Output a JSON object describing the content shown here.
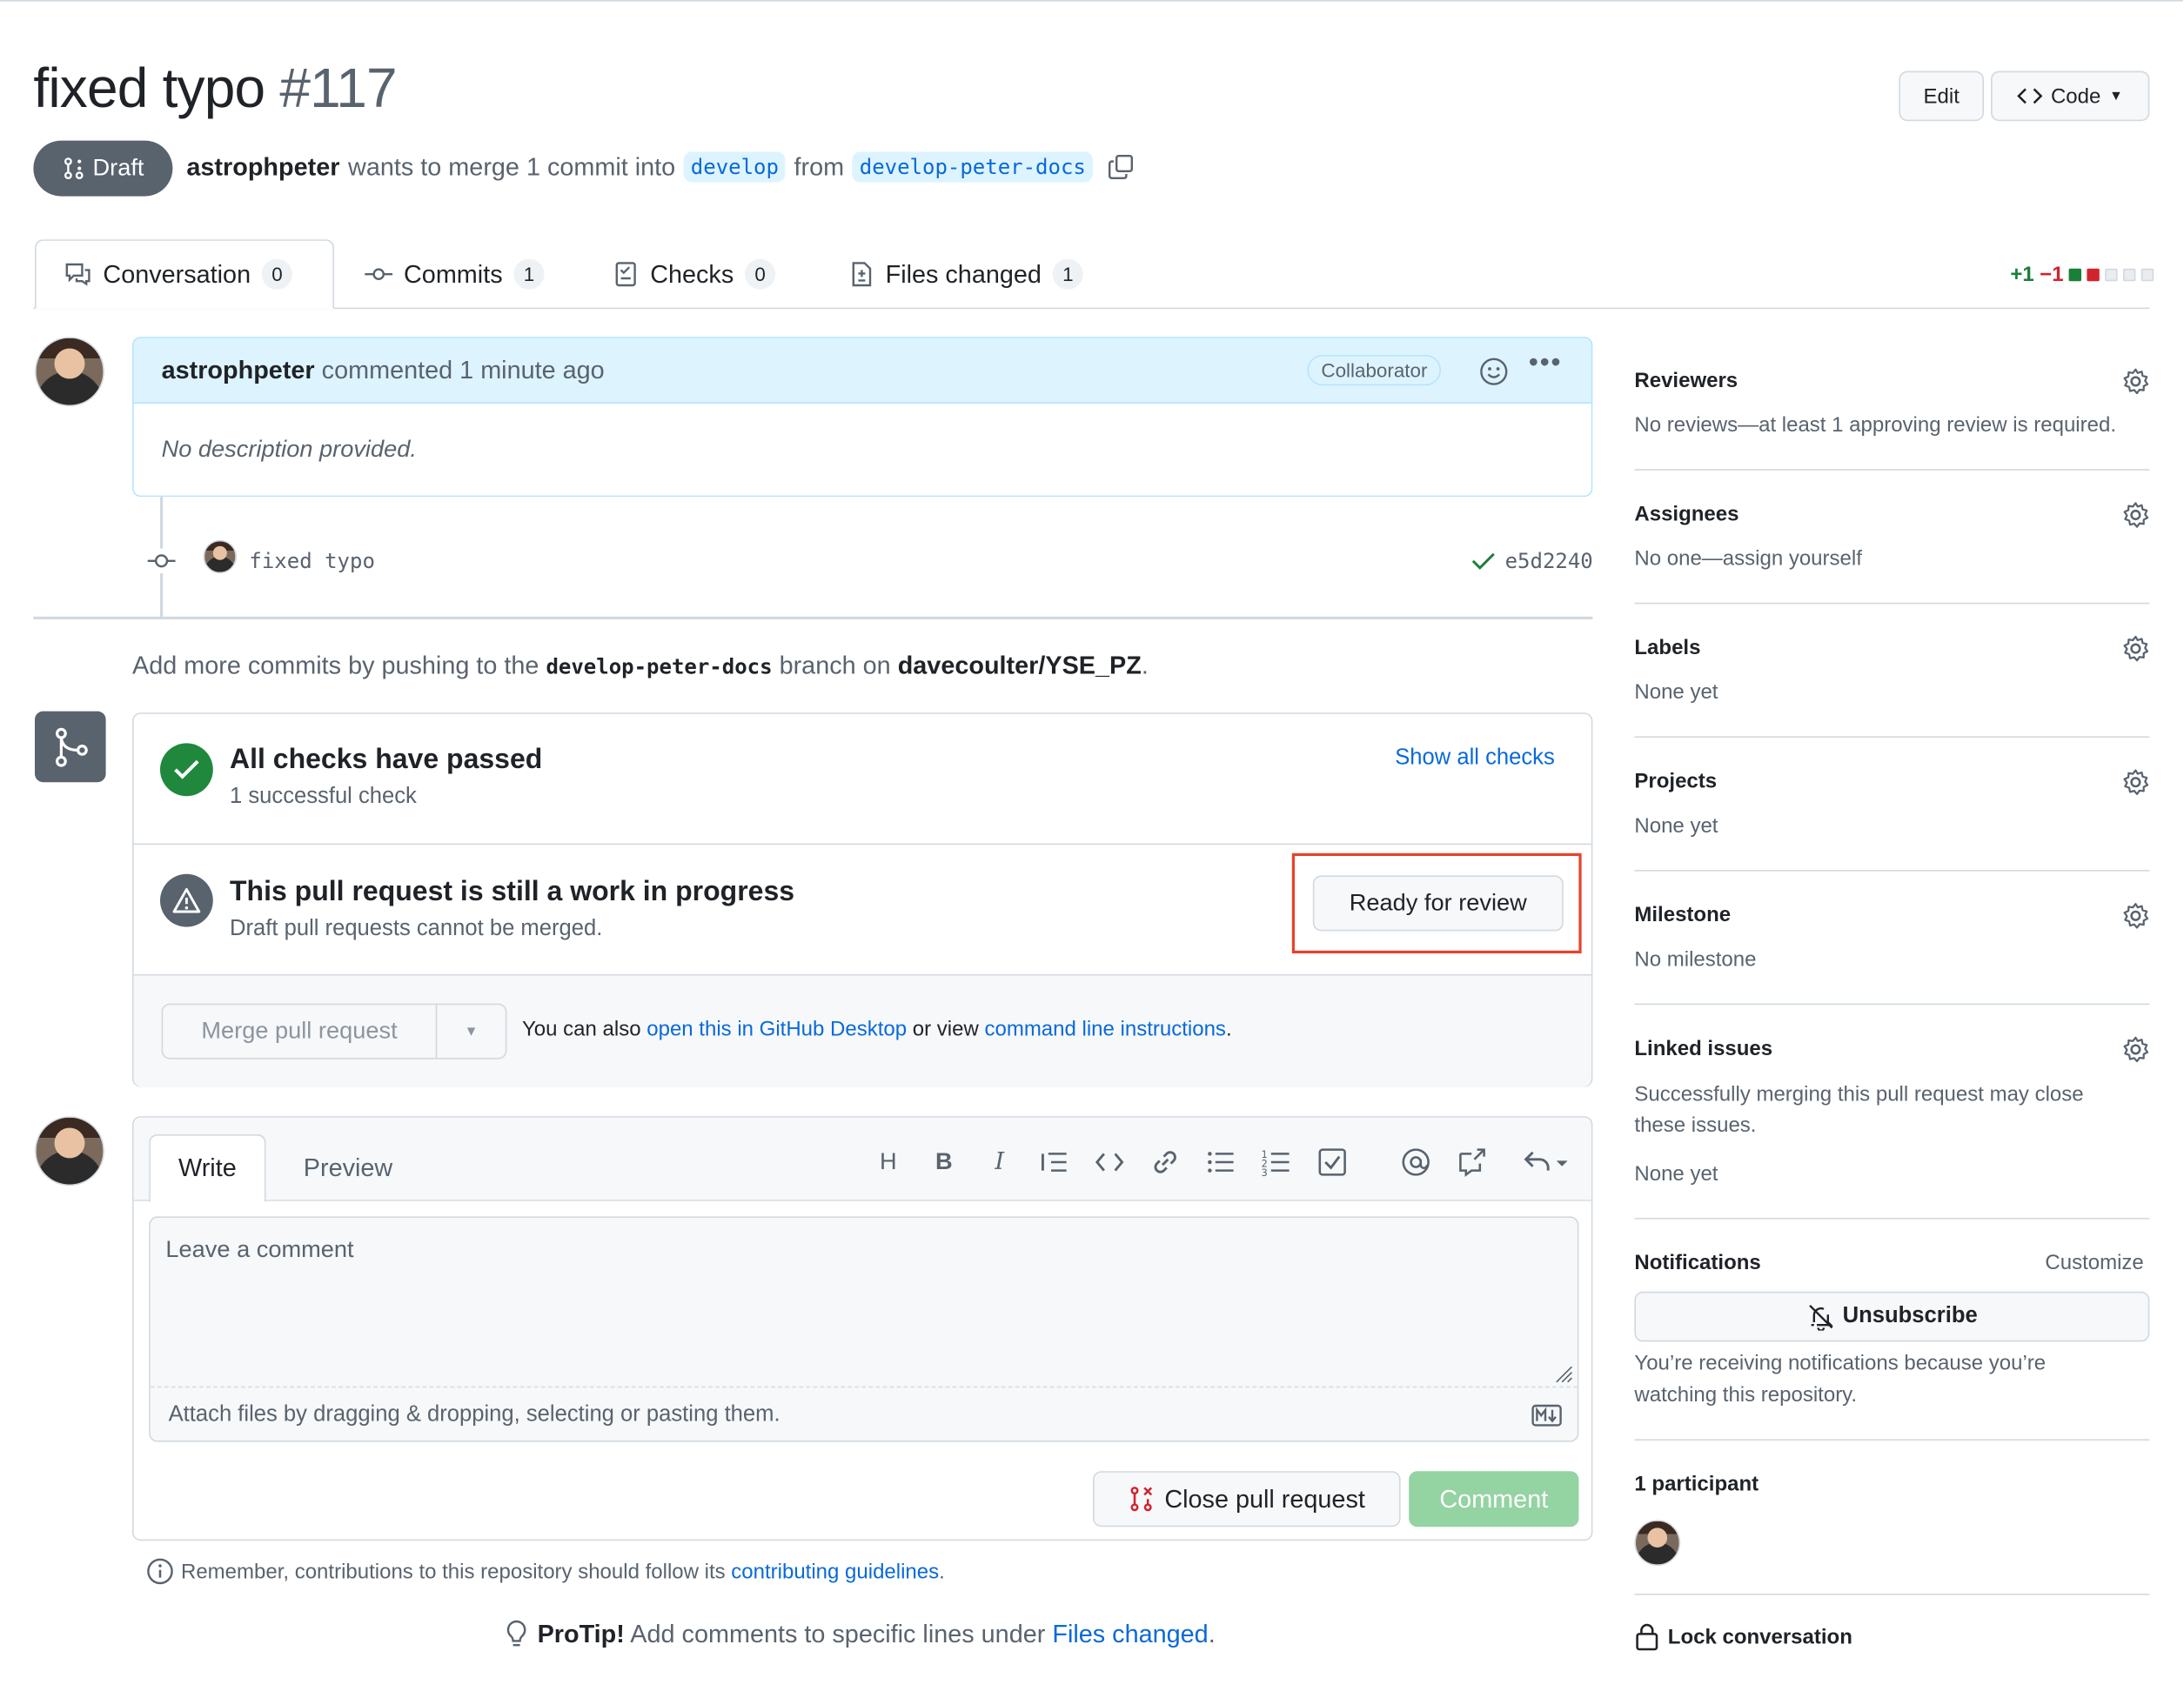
{
  "pr": {
    "title": "fixed typo",
    "number": "#117",
    "state": "Draft",
    "author": "astrophpeter",
    "merge_text": "wants to merge 1 commit into",
    "base_branch": "develop",
    "from_text": "from",
    "head_branch": "develop-peter-docs"
  },
  "header_buttons": {
    "edit": "Edit",
    "code": "Code"
  },
  "tabs": [
    {
      "label": "Conversation",
      "count": "0",
      "icon": "comment-discussion-icon"
    },
    {
      "label": "Commits",
      "count": "1",
      "icon": "git-commit-icon"
    },
    {
      "label": "Checks",
      "count": "0",
      "icon": "checklist-icon"
    },
    {
      "label": "Files changed",
      "count": "1",
      "icon": "file-diff-icon"
    }
  ],
  "diffstat": {
    "additions": "+1",
    "deletions": "−1"
  },
  "comment": {
    "author": "astrophpeter",
    "action": "commented",
    "time": "1 minute ago",
    "badge": "Collaborator",
    "body": "No description provided."
  },
  "commit": {
    "message": "fixed typo",
    "sha": "e5d2240"
  },
  "push_hint": {
    "prefix": "Add more commits by pushing to the",
    "branch": "develop-peter-docs",
    "middle": "branch on",
    "repo": "davecoulter/YSE_PZ",
    "suffix": "."
  },
  "checks": {
    "title": "All checks have passed",
    "subtitle": "1 successful check",
    "show_all": "Show all checks"
  },
  "wip": {
    "title": "This pull request is still a work in progress",
    "subtitle": "Draft pull requests cannot be merged.",
    "ready_button": "Ready for review"
  },
  "merge": {
    "button": "Merge pull request",
    "also_prefix": "You can also",
    "desktop_link": "open this in GitHub Desktop",
    "or_view": "or view",
    "cli_link": "command line instructions",
    "suffix": "."
  },
  "editor": {
    "write_tab": "Write",
    "preview_tab": "Preview",
    "placeholder": "Leave a comment",
    "attach_text": "Attach files by dragging & dropping, selecting or pasting them.",
    "close_button": "Close pull request",
    "comment_button": "Comment"
  },
  "footer": {
    "remember_prefix": "Remember, contributions to this repository should follow its",
    "guidelines_link": "contributing guidelines",
    "remember_suffix": ".",
    "protip_label": "ProTip!",
    "protip_text": "Add comments to specific lines under",
    "protip_link": "Files changed",
    "protip_suffix": "."
  },
  "sidebar": {
    "reviewers": {
      "title": "Reviewers",
      "text": "No reviews—at least 1 approving review is required."
    },
    "assignees": {
      "title": "Assignees",
      "text": "No one—assign yourself"
    },
    "labels": {
      "title": "Labels",
      "text": "None yet"
    },
    "projects": {
      "title": "Projects",
      "text": "None yet"
    },
    "milestone": {
      "title": "Milestone",
      "text": "No milestone"
    },
    "linked": {
      "title": "Linked issues",
      "text1": "Successfully merging this pull request may close",
      "text2": "these issues.",
      "text3": "None yet"
    },
    "notifications": {
      "title": "Notifications",
      "customize": "Customize",
      "unsubscribe": "Unsubscribe",
      "reason1": "You’re receiving notifications because you’re",
      "reason2": "watching this repository."
    },
    "participants": {
      "title": "1 participant"
    },
    "lock": "Lock conversation"
  },
  "colors": {
    "accent": "#0969da",
    "success": "#1a7f37",
    "danger": "#d1242f",
    "highlight": "#e5432c",
    "comment_disabled": "#94d3a2"
  }
}
